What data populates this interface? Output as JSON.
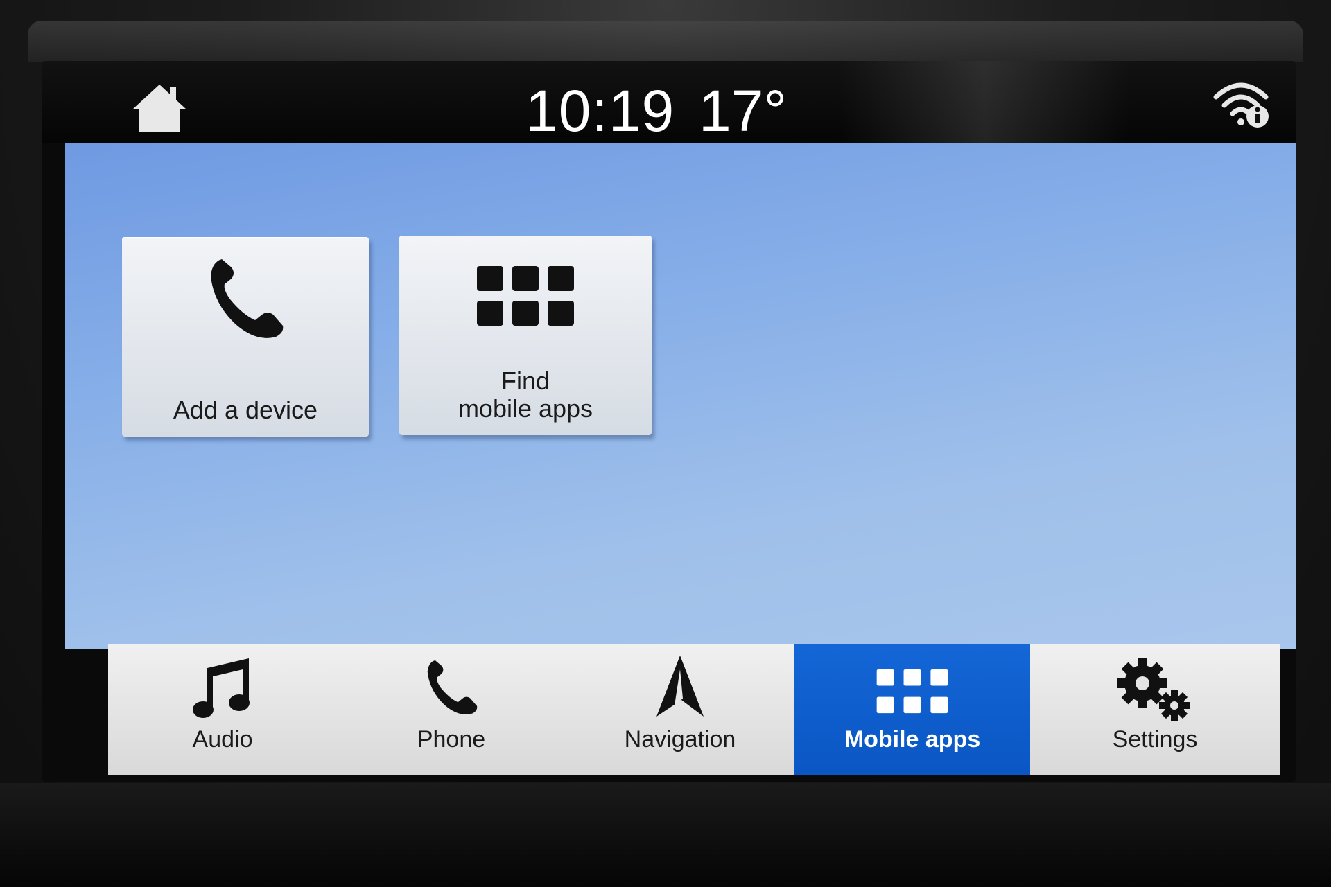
{
  "status_bar": {
    "time": "10:19",
    "temperature": "17°",
    "home_icon": "home-icon",
    "wifi_icon": "wifi-info-icon"
  },
  "tiles": [
    {
      "label": "Add a device",
      "icon": "phone-handset-icon"
    },
    {
      "label_line1": "Find",
      "label_line2": "mobile apps",
      "icon": "app-grid-icon"
    }
  ],
  "nav": {
    "items": [
      {
        "label": "Audio",
        "icon": "music-note-icon",
        "active": false
      },
      {
        "label": "Phone",
        "icon": "phone-handset-icon",
        "active": false
      },
      {
        "label": "Navigation",
        "icon": "navigation-arrow-icon",
        "active": false
      },
      {
        "label": "Mobile apps",
        "icon": "app-grid-icon",
        "active": true
      },
      {
        "label": "Settings",
        "icon": "gears-icon",
        "active": false
      }
    ]
  },
  "colors": {
    "active_tab": "#1466d6",
    "background_blue": "#86aee8",
    "tile": "#e6eaef"
  }
}
